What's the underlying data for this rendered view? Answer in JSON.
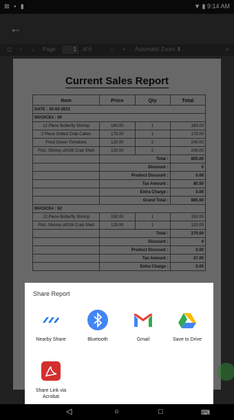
{
  "status_bar": {
    "left_icons": [
      "notification-icon",
      "image-icon",
      "sim-icon"
    ],
    "time": "9:14 AM"
  },
  "pdf_toolbar": {
    "page_label": "Page",
    "page_number": "1",
    "page_total": "of 6",
    "zoom": "Automatic Zoom"
  },
  "report": {
    "title": "Current Sales Report",
    "columns": [
      "Item",
      "Price",
      "Qty",
      "Total"
    ],
    "date": "DATE : 02-02-2021",
    "invoice1": {
      "label": "INVOICE# : 60",
      "items": [
        [
          "12 Piece Butterfly Shrimp",
          "180.00",
          "1",
          "180.00"
        ],
        [
          "2 Piece Grilled Crab Cakes",
          "175.00",
          "1",
          "175.00"
        ],
        [
          "Fried Green Tomatoes",
          "120.00",
          "2",
          "240.00"
        ],
        [
          "Fish, Shrimp u0026 Crab Shell",
          "120.00",
          "2",
          "240.00"
        ]
      ],
      "summary": [
        [
          "Total :",
          "805.00"
        ],
        [
          "Discount :",
          "0"
        ],
        [
          "Product Discount :",
          "0.00"
        ],
        [
          "Tax Amount :",
          "80.50"
        ],
        [
          "Extra Charge :",
          "0.00"
        ],
        [
          "Grand Total :",
          "885.50"
        ]
      ]
    },
    "invoice2": {
      "label": "INVOICE# : 62",
      "items": [
        [
          "12 Piece Butterfly Shrimp",
          "150.00",
          "1",
          "150.00"
        ],
        [
          "Fish, Shrimp u0026 Crab Shell",
          "120.00",
          "1",
          "120.00"
        ]
      ],
      "summary": [
        [
          "Total :",
          "270.00"
        ],
        [
          "Discount :",
          "0"
        ],
        [
          "Product Discount :",
          "0.00"
        ],
        [
          "Tax Amount :",
          "27.00"
        ],
        [
          "Extra Charge :",
          "0.00"
        ]
      ]
    }
  },
  "share": {
    "title": "Share Report",
    "options": [
      {
        "label": "Nearby Share",
        "icon": "nearby-share-icon"
      },
      {
        "label": "Bluetooth",
        "icon": "bluetooth-icon"
      },
      {
        "label": "Gmail",
        "icon": "gmail-icon"
      },
      {
        "label": "Save to Drive",
        "icon": "drive-icon"
      },
      {
        "label": "Share Link via Acrobat",
        "icon": "acrobat-icon"
      }
    ]
  },
  "colors": {
    "bluetooth": "#4285f4",
    "acrobat": "#d32f2f",
    "nearby": "#1a73e8",
    "fab": "#2e7d32"
  }
}
